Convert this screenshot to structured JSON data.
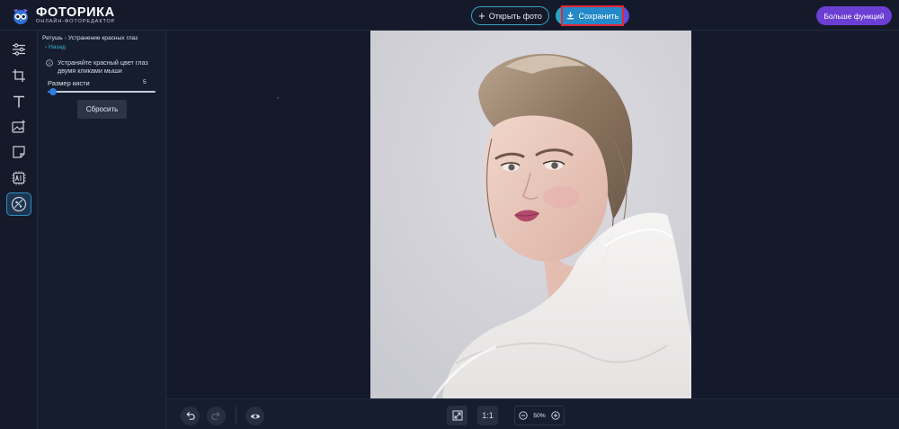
{
  "app": {
    "logo_title": "ФОТОРИКА",
    "logo_subtitle": "ОНЛАЙН-ФОТОРЕДАКТОР"
  },
  "header": {
    "open_label": "Открыть фото",
    "save_label": "Сохранить",
    "more_label": "Больше функций"
  },
  "rail": {
    "items": [
      {
        "icon": "sliders-icon"
      },
      {
        "icon": "crop-icon"
      },
      {
        "icon": "text-icon"
      },
      {
        "icon": "image-add-icon"
      },
      {
        "icon": "sticker-icon"
      },
      {
        "icon": "ai-chip-icon"
      },
      {
        "icon": "retouch-icon",
        "active": true
      }
    ]
  },
  "panel": {
    "breadcrumb_parent": "Ретушь",
    "breadcrumb_current": "Устранение красных глаз",
    "back_label": "‹ Назад",
    "info_text": "Устраняйте красный цвет глаз двумя кликами мыши",
    "brush_label": "Размер кисти",
    "brush_value": "5",
    "brush_fraction": 0.05,
    "reset_label": "Сбросить"
  },
  "bottom": {
    "fit_label": "1:1",
    "zoom_value": "50%"
  },
  "colors": {
    "accent_teal": "#35b3c9",
    "accent_purple": "#6b3fd4",
    "highlight_red": "#e32636",
    "slider_blue": "#2f7ee6"
  }
}
